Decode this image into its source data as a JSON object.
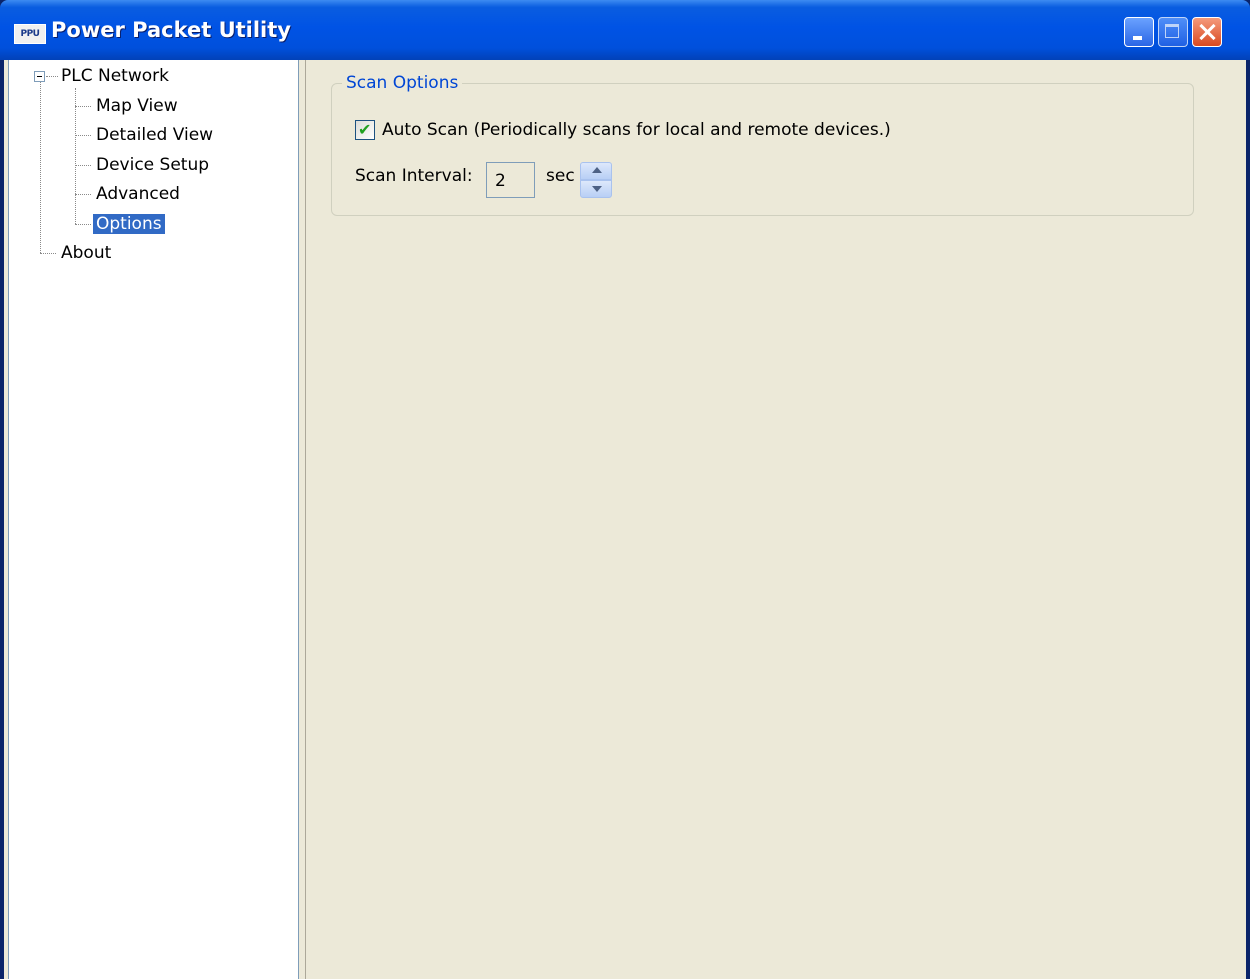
{
  "window": {
    "icon_text": "PPU",
    "title": "Power Packet Utility"
  },
  "tree": {
    "root": "PLC Network",
    "children": [
      "Map View",
      "Detailed View",
      "Device Setup",
      "Advanced",
      "Options"
    ],
    "selected": "Options",
    "sibling": "About"
  },
  "scan_options": {
    "legend": "Scan Options",
    "auto_scan_checked": true,
    "auto_scan_label": "Auto Scan (Periodically scans for local and remote devices.)",
    "interval_label": "Scan Interval:",
    "interval_value": "2",
    "interval_unit": "sec"
  },
  "colors": {
    "selection": "#316ac5",
    "titlebar": "#0053e5",
    "legend_text": "#0046d5"
  }
}
